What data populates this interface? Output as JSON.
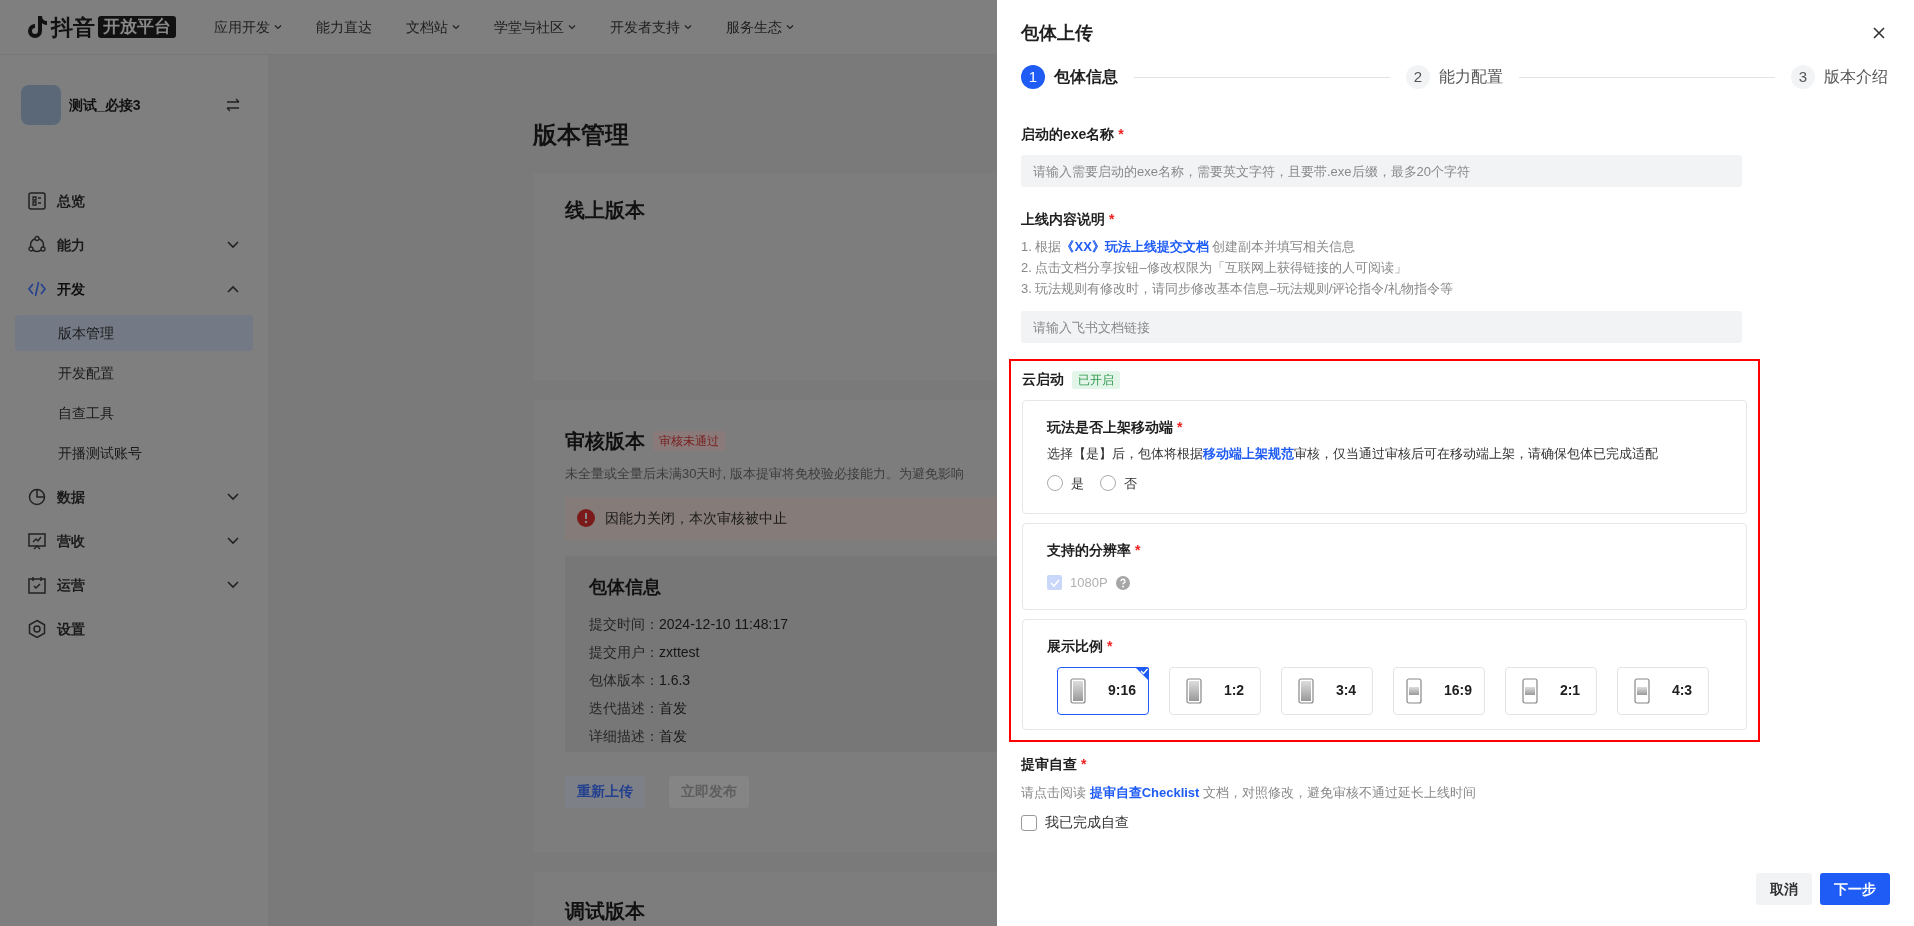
{
  "top_nav": {
    "logo_text": "抖音",
    "logo_badge": "开放平台",
    "items": [
      {
        "label": "应用开发",
        "dropdown": true
      },
      {
        "label": "能力直达",
        "dropdown": false
      },
      {
        "label": "文档站",
        "dropdown": true
      },
      {
        "label": "学堂与社区",
        "dropdown": true
      },
      {
        "label": "开发者支持",
        "dropdown": true
      },
      {
        "label": "服务生态",
        "dropdown": true
      }
    ]
  },
  "sidebar": {
    "app_name": "测试_必接3",
    "items": [
      {
        "label": "总览",
        "selected": false
      },
      {
        "label": "能力",
        "expanded": false,
        "selected": false
      },
      {
        "label": "开发",
        "expanded": true,
        "selected": true,
        "children": [
          {
            "label": "版本管理",
            "selected": true
          },
          {
            "label": "开发配置",
            "selected": false
          },
          {
            "label": "自查工具",
            "selected": false
          },
          {
            "label": "开播测试账号",
            "selected": false
          }
        ]
      },
      {
        "label": "数据",
        "expanded": false,
        "selected": false
      },
      {
        "label": "营收",
        "expanded": false,
        "selected": false
      },
      {
        "label": "运营",
        "expanded": false,
        "selected": false
      },
      {
        "label": "设置",
        "selected": false
      }
    ]
  },
  "main": {
    "title": "版本管理",
    "online": {
      "title": "线上版本"
    },
    "review": {
      "title": "审核版本",
      "badge": "审核未通过",
      "note": "未全量或全量后未满30天时, 版本提审将免校验必接能力。为避免影响",
      "alert": "因能力关闭，本次审核被中止",
      "package_info": {
        "title": "包体信息",
        "rows": [
          {
            "label": "提交时间：",
            "value": "2024-12-10 11:48:17"
          },
          {
            "label": "提交用户：",
            "value": "zxttest"
          },
          {
            "label": "包体版本：",
            "value": "1.6.3"
          },
          {
            "label": "迭代描述：",
            "value": "首发"
          },
          {
            "label": "详细描述：",
            "value": "首发"
          }
        ]
      },
      "buttons": [
        {
          "label": "重新上传",
          "disabled": false
        },
        {
          "label": "立即发布",
          "disabled": true
        }
      ]
    },
    "debug": {
      "title": "调试版本"
    }
  },
  "drawer": {
    "title": "包体上传",
    "steps": [
      {
        "number": "1",
        "label": "包体信息",
        "selected": true
      },
      {
        "number": "2",
        "label": "能力配置",
        "selected": false
      },
      {
        "number": "3",
        "label": "版本介绍",
        "selected": false
      }
    ],
    "exe_name": {
      "label": "启动的exe名称",
      "required": "*",
      "placeholder": "请输入需要启动的exe名称，需要英文字符，且要带.exe后缀，最多20个字符"
    },
    "content_description": {
      "label": "上线内容说明",
      "required": "*",
      "lines": [
        {
          "text": "1. 根据",
          "link": "《XX》玩法上线提交文档",
          "after": " 创建副本并填写相关信息"
        },
        {
          "text": "2. 点击文档分享按钮–修改权限为「互联网上获得链接的人可阅读」"
        },
        {
          "text": "3. 玩法规则有修改时，请同步修改基本信息–玩法规则/评论指令/礼物指令等"
        }
      ],
      "placeholder": "请输入飞书文档链接"
    },
    "cloud_launch": {
      "label": "云启动",
      "badge": "已开启",
      "highlighted": true,
      "mobile": {
        "label": "玩法是否上架移动端",
        "required": "*",
        "before": "选择【是】后，包体将根据",
        "link": "移动端上架规范",
        "after": "审核，仅当通过审核后可在移动端上架，请确保包体已完成适配",
        "options": [
          {
            "label": "是",
            "selected": false
          },
          {
            "label": "否",
            "selected": false
          }
        ]
      },
      "resolution": {
        "label": "支持的分辨率",
        "required": "*",
        "options": [
          {
            "label": "1080P",
            "checked": true,
            "disabled": true
          }
        ]
      },
      "ratio": {
        "label": "展示比例",
        "required": "*",
        "options": [
          {
            "label": "9:16",
            "selected": true,
            "portrait": true
          },
          {
            "label": "1:2",
            "selected": false,
            "portrait": true
          },
          {
            "label": "3:4",
            "selected": false,
            "portrait": true
          },
          {
            "label": "16:9",
            "selected": false,
            "portrait": false
          },
          {
            "label": "2:1",
            "selected": false,
            "portrait": false
          },
          {
            "label": "4:3",
            "selected": false,
            "portrait": false
          }
        ]
      }
    },
    "self_check": {
      "label": "提审自查",
      "required": "*",
      "before": "请点击阅读 ",
      "link": "提审自查Checklist",
      "after": " 文档，对照修改，避免审核不通过延长上线时间",
      "checkbox": {
        "label": "我已完成自查",
        "checked": false
      }
    },
    "buttons": [
      {
        "label": "取消",
        "kind": "secondary"
      },
      {
        "label": "下一步",
        "kind": "primary"
      }
    ]
  }
}
